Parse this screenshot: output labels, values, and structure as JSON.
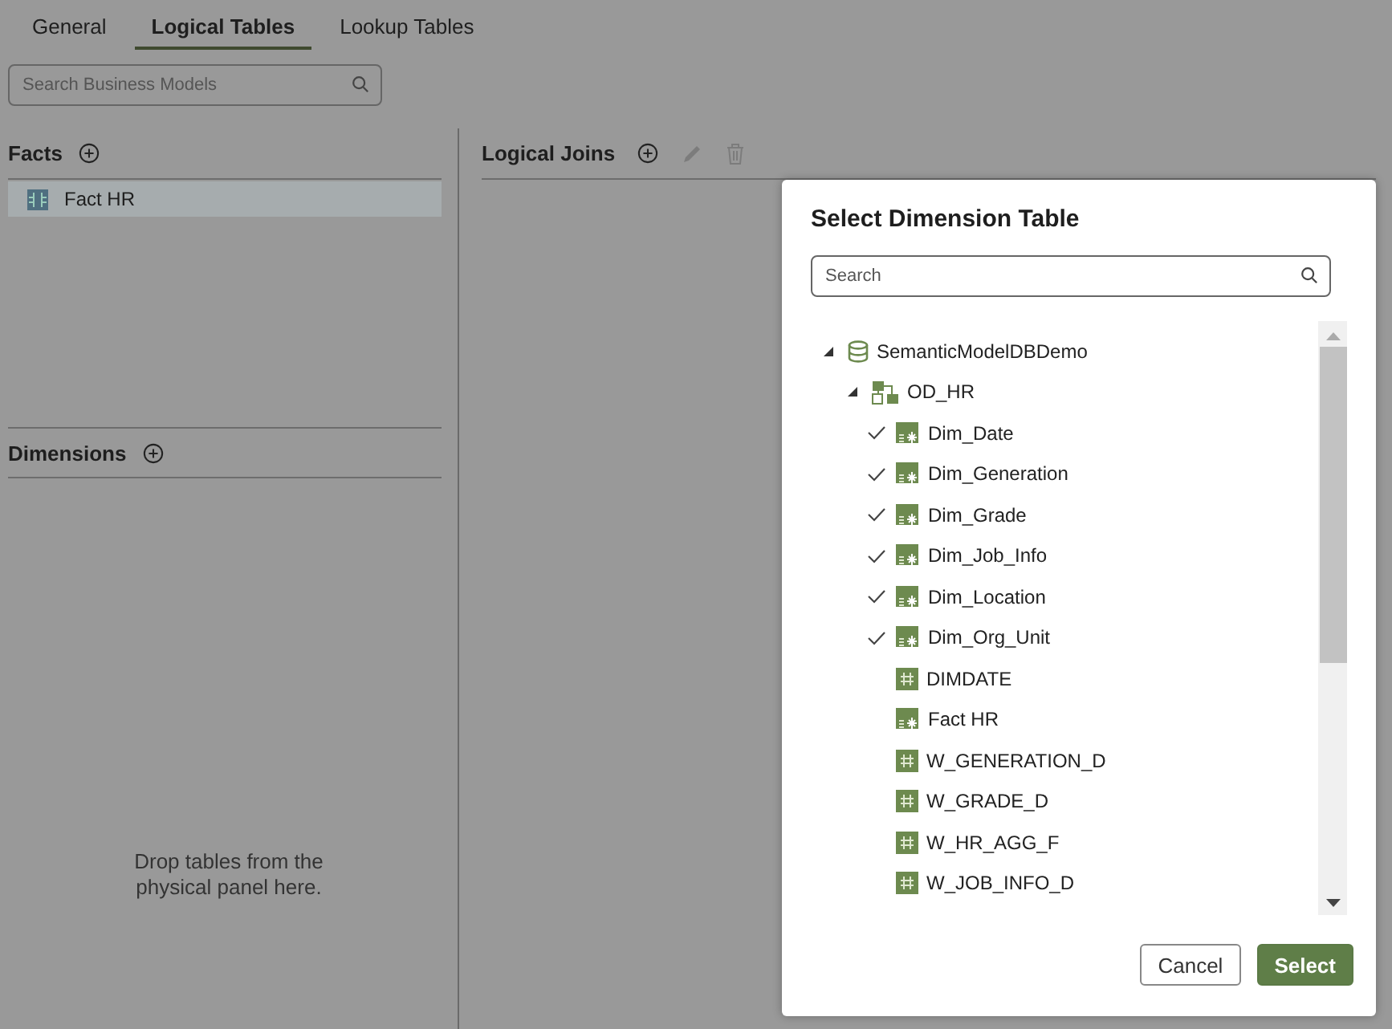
{
  "tabs": [
    {
      "label": "General",
      "selected": false
    },
    {
      "label": "Logical Tables",
      "selected": true
    },
    {
      "label": "Lookup Tables",
      "selected": false
    }
  ],
  "search": {
    "placeholder": "Search Business Models"
  },
  "facts": {
    "title": "Facts",
    "items": [
      {
        "label": "Fact HR",
        "selected": true
      }
    ]
  },
  "dimensions": {
    "title": "Dimensions",
    "empty_text": "Drop tables from the physical panel here."
  },
  "logical_joins": {
    "title": "Logical Joins"
  },
  "dialog": {
    "title": "Select Dimension Table",
    "search": {
      "placeholder": "Search"
    },
    "tree": [
      {
        "label": "SemanticModelDBDemo",
        "kind": "database",
        "expanded": true,
        "children": [
          {
            "label": "OD_HR",
            "kind": "schema",
            "expanded": true,
            "children": [
              {
                "label": "Dim_Date",
                "kind": "logical",
                "checked": true
              },
              {
                "label": "Dim_Generation",
                "kind": "logical",
                "checked": true
              },
              {
                "label": "Dim_Grade",
                "kind": "logical",
                "checked": true
              },
              {
                "label": "Dim_Job_Info",
                "kind": "logical",
                "checked": true
              },
              {
                "label": "Dim_Location",
                "kind": "logical",
                "checked": true
              },
              {
                "label": "Dim_Org_Unit",
                "kind": "logical",
                "checked": true
              },
              {
                "label": "DIMDATE",
                "kind": "physical",
                "checked": false
              },
              {
                "label": "Fact HR",
                "kind": "logical",
                "checked": false
              },
              {
                "label": "W_GENERATION_D",
                "kind": "physical",
                "checked": false
              },
              {
                "label": "W_GRADE_D",
                "kind": "physical",
                "checked": false
              },
              {
                "label": "W_HR_AGG_F",
                "kind": "physical",
                "checked": false
              },
              {
                "label": "W_JOB_INFO_D",
                "kind": "physical",
                "checked": false
              }
            ]
          }
        ]
      }
    ],
    "buttons": [
      {
        "label": "Cancel",
        "kind": "secondary"
      },
      {
        "label": "Select",
        "kind": "primary"
      }
    ]
  }
}
